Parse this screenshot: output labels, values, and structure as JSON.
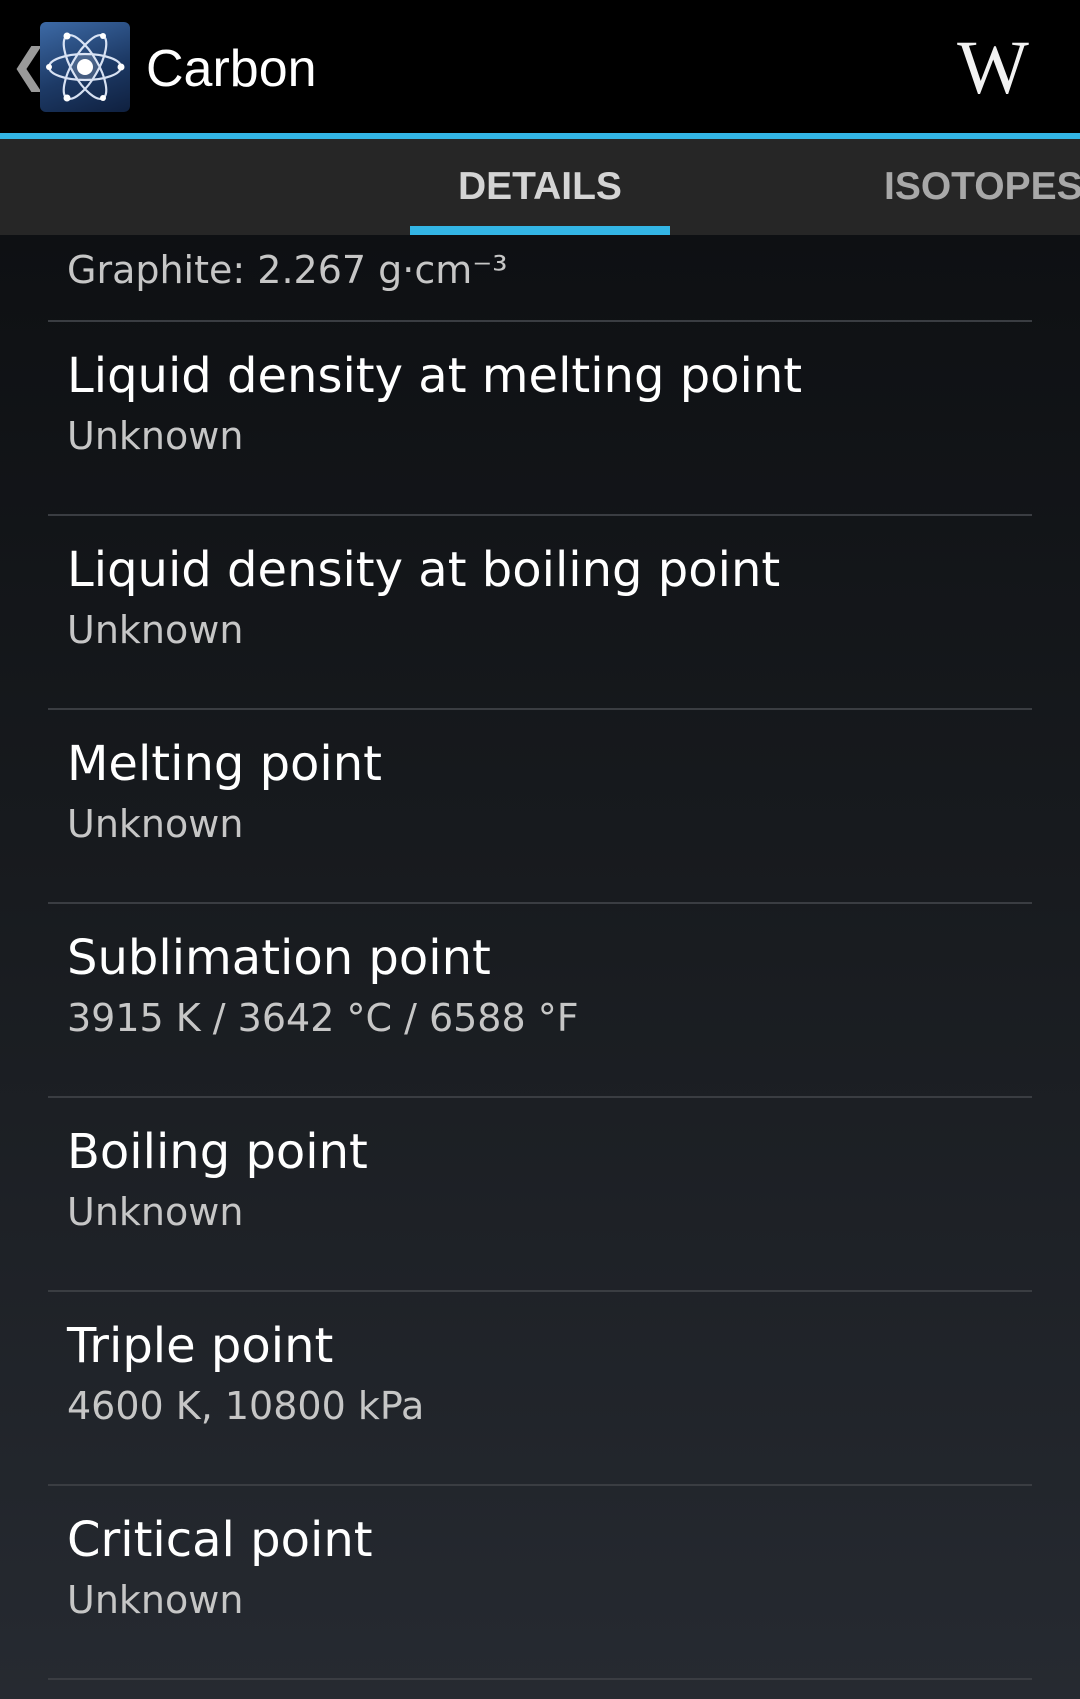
{
  "action_bar": {
    "back_glyph": "❮",
    "app_icon": "atom-icon",
    "title": "Carbon",
    "wiki_label": "W"
  },
  "tabs": [
    {
      "label": "DETAILS",
      "selected": true
    },
    {
      "label": "ISOTOPES",
      "selected": false
    }
  ],
  "colors": {
    "accent": "#33b5e5",
    "background": "#000000"
  },
  "list": {
    "partial_value": "Graphite: 2.267 g·cm⁻³",
    "items": [
      {
        "label": "Liquid density at melting point",
        "value": "Unknown"
      },
      {
        "label": "Liquid density at boiling point",
        "value": "Unknown"
      },
      {
        "label": "Melting point",
        "value": "Unknown"
      },
      {
        "label": "Sublimation point",
        "value": "3915 K / 3642 °C / 6588 °F"
      },
      {
        "label": "Boiling point",
        "value": "Unknown"
      },
      {
        "label": "Triple point",
        "value": "4600 K, 10800 kPa"
      },
      {
        "label": "Critical point",
        "value": "Unknown"
      }
    ]
  }
}
